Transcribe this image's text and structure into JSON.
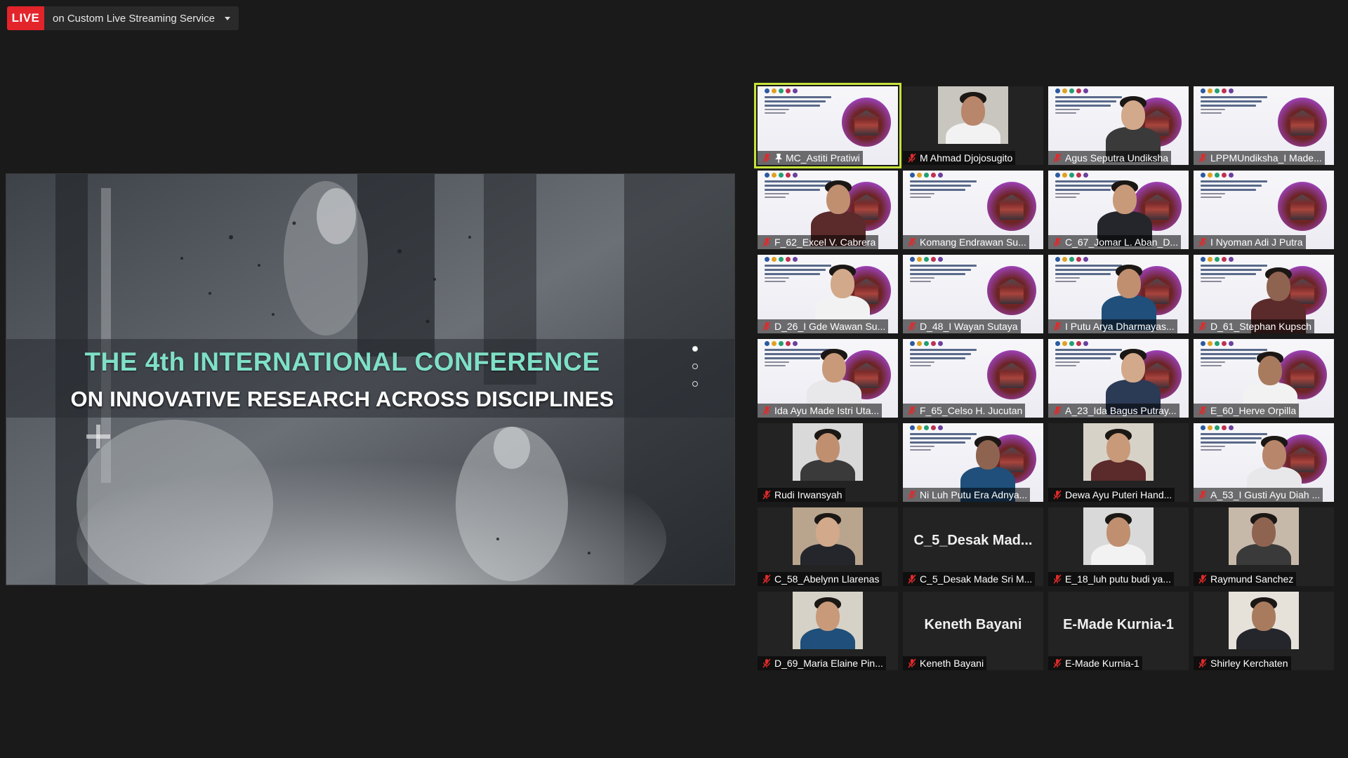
{
  "live": {
    "badge": "LIVE",
    "service": "on Custom Live Streaming Service"
  },
  "share": {
    "title_line1": "THE 4th INTERNATIONAL CONFERENCE",
    "title_line2": "ON INNOVATIVE RESEARCH ACROSS DISCIPLINES"
  },
  "participants": [
    {
      "name": "MC_Astiti Pratiwi",
      "kind": "slide",
      "active": true,
      "pinned": true,
      "muted": true
    },
    {
      "name": "M Ahmad Djojosugito",
      "kind": "camera",
      "muted": true
    },
    {
      "name": "Agus Seputra Undiksha",
      "kind": "slide-person",
      "muted": true
    },
    {
      "name": "LPPMUndiksha_I Made...",
      "kind": "slide",
      "muted": true
    },
    {
      "name": "F_62_Excel V. Cabrera",
      "kind": "slide-person",
      "muted": true
    },
    {
      "name": "Komang Endrawan Su...",
      "kind": "slide",
      "muted": true
    },
    {
      "name": "C_67_Jomar L. Aban_D...",
      "kind": "slide-person",
      "muted": true
    },
    {
      "name": "I Nyoman Adi J Putra",
      "kind": "slide",
      "muted": true
    },
    {
      "name": "D_26_I Gde Wawan Su...",
      "kind": "slide-person",
      "muted": true
    },
    {
      "name": "D_48_I Wayan Sutaya",
      "kind": "slide",
      "muted": true
    },
    {
      "name": "I Putu Arya Dharmayas...",
      "kind": "slide-person",
      "muted": true
    },
    {
      "name": "D_61_Stephan Kupsch",
      "kind": "slide-person",
      "muted": true
    },
    {
      "name": "Ida Ayu Made Istri Uta...",
      "kind": "slide-person",
      "muted": true
    },
    {
      "name": "F_65_Celso H. Jucutan",
      "kind": "slide",
      "muted": true
    },
    {
      "name": "A_23_Ida Bagus Putray...",
      "kind": "slide-person",
      "muted": true
    },
    {
      "name": "E_60_Herve Orpilla",
      "kind": "slide-person",
      "muted": true
    },
    {
      "name": "Rudi Irwansyah",
      "kind": "camera",
      "muted": true
    },
    {
      "name": "Ni Luh Putu Era Adnya...",
      "kind": "slide-person",
      "muted": true
    },
    {
      "name": "Dewa Ayu Puteri Hand...",
      "kind": "camera",
      "muted": true
    },
    {
      "name": "A_53_I Gusti Ayu Diah ...",
      "kind": "slide-person",
      "muted": true
    },
    {
      "name": "C_58_Abelynn Llarenas",
      "kind": "camera",
      "muted": true
    },
    {
      "name": "C_5_Desak Made Sri M...",
      "kind": "text",
      "big": "C_5_Desak  Mad...",
      "muted": true
    },
    {
      "name": "E_18_luh putu budi ya...",
      "kind": "camera",
      "muted": true
    },
    {
      "name": "Raymund Sanchez",
      "kind": "camera",
      "muted": true
    },
    {
      "name": "D_69_Maria Elaine Pin...",
      "kind": "camera",
      "muted": true
    },
    {
      "name": "Keneth Bayani",
      "kind": "text",
      "big": "Keneth Bayani",
      "muted": true
    },
    {
      "name": "E-Made Kurnia-1",
      "kind": "text",
      "big": "E-Made Kurnia-1",
      "muted": true
    },
    {
      "name": "Shirley Kerchaten",
      "kind": "camera",
      "muted": true
    }
  ],
  "colors": {
    "live_red": "#e3242b",
    "active_border": "#c7e23a",
    "title_teal": "#7fe0c7",
    "mute_red": "#e02a2a"
  }
}
